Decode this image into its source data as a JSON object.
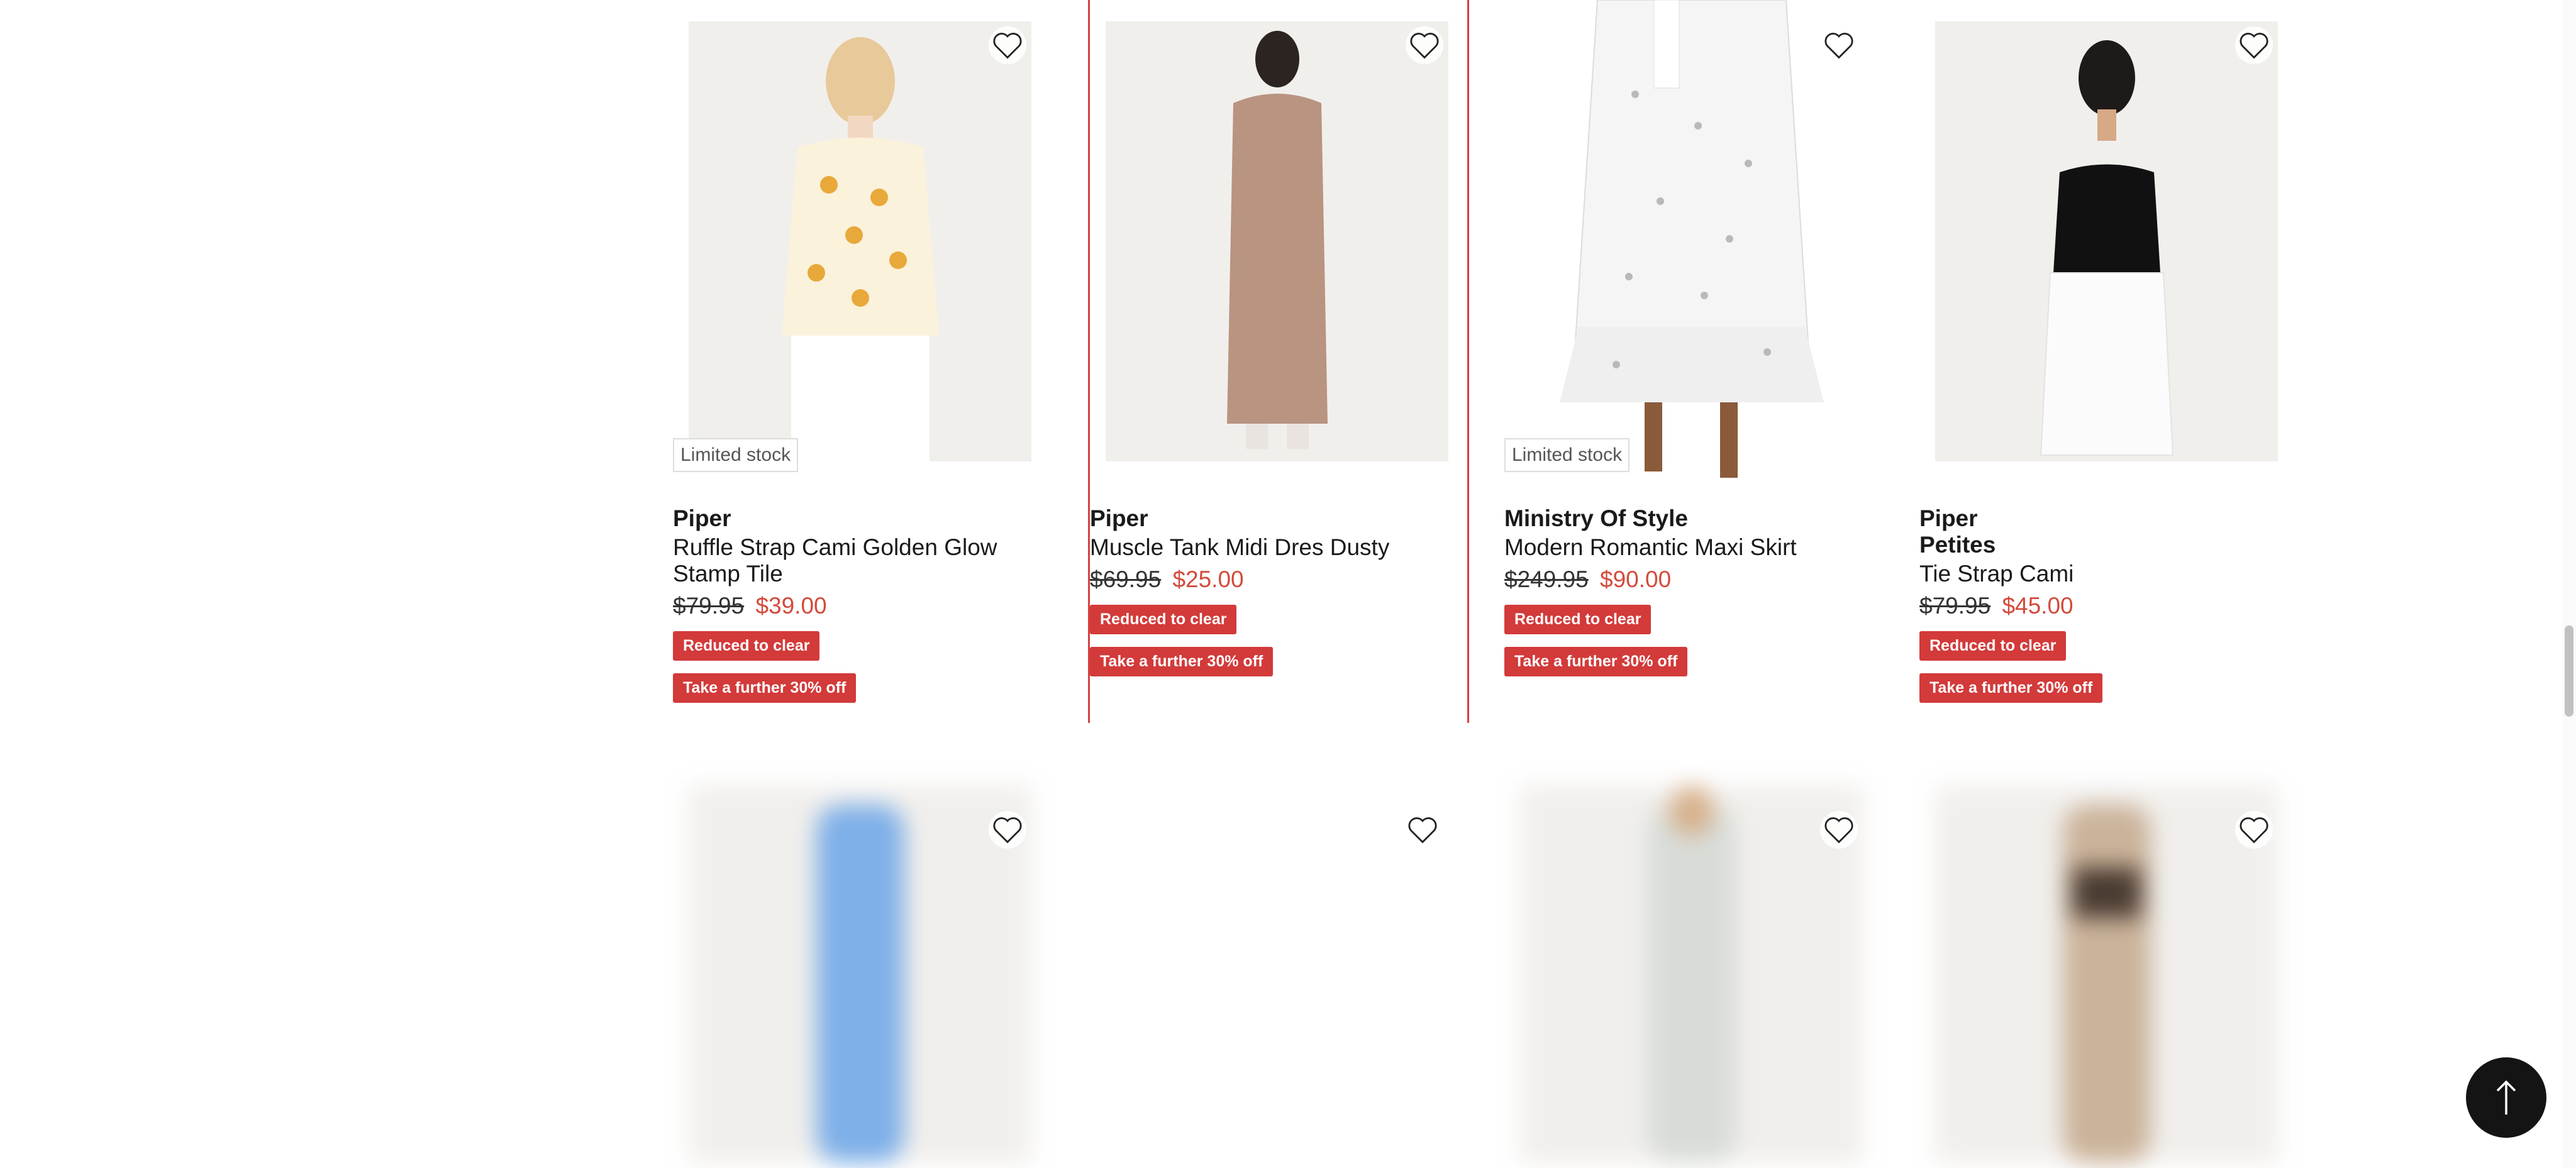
{
  "products": [
    {
      "brand": "Piper",
      "sub_brand": "",
      "name": "Ruffle Strap Cami Golden Glow Stamp Tile",
      "was_price": "$79.95",
      "now_price": "$39.00",
      "stock_tag": "Limited stock",
      "badges": [
        "Reduced to clear",
        "Take a further 30% off"
      ]
    },
    {
      "brand": "Piper",
      "sub_brand": "",
      "name": "Muscle Tank Midi Dres Dusty",
      "was_price": "$69.95",
      "now_price": "$25.00",
      "stock_tag": "",
      "badges": [
        "Reduced to clear",
        "Take a further 30% off"
      ]
    },
    {
      "brand": "Ministry Of Style",
      "sub_brand": "",
      "name": "Modern Romantic Maxi Skirt",
      "was_price": "$249.95",
      "now_price": "$90.00",
      "stock_tag": "Limited stock",
      "badges": [
        "Reduced to clear",
        "Take a further 30% off"
      ]
    },
    {
      "brand": "Piper",
      "sub_brand": "Petites",
      "name": "Tie Strap Cami",
      "was_price": "$79.95",
      "now_price": "$45.00",
      "stock_tag": "",
      "badges": [
        "Reduced to clear",
        "Take a further 30% off"
      ]
    }
  ],
  "colors": {
    "badge_red": "#d33a3a",
    "sale_price": "#d34a3a",
    "highlight_border": "#d94040"
  },
  "icons": {
    "wishlist": "heart-outline-icon",
    "back_to_top": "arrow-up-icon"
  }
}
